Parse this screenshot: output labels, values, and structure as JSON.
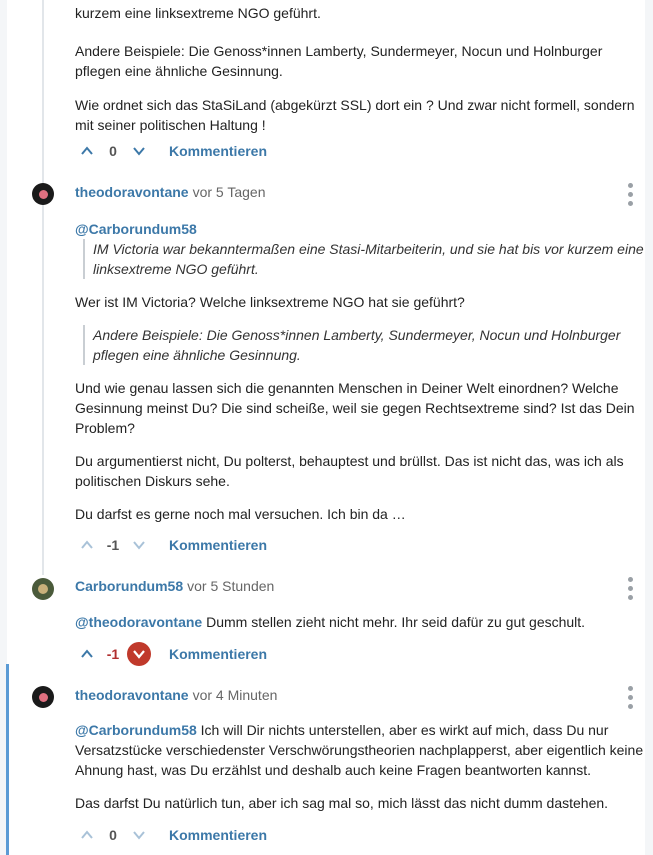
{
  "comments": [
    {
      "paragraphs": [
        "kurzem eine linksextreme NGO geführt.",
        "Andere Beispiele: Die Genoss*innen Lamberty, Sundermeyer, Nocun und Holnburger pflegen eine ähnliche Gesinnung.",
        "Wie ordnet sich das StaSiLand (abgekürzt SSL) dort ein ? Und zwar nicht formell, sondern mit seiner politischen Haltung !"
      ],
      "votes": "0",
      "comment_label": "Kommentieren"
    },
    {
      "user": "theodoravontane",
      "time": "vor 5 Tagen",
      "mention": "@Carborundum58",
      "quote1": "IM Victoria war bekanntermaßen eine Stasi-Mitarbeiterin, und sie hat bis vor kurzem eine linksextreme NGO geführt.",
      "p1": "Wer ist IM Victoria? Welche linksextreme NGO hat sie geführt?",
      "quote2": "Andere Beispiele: Die Genoss*innen Lamberty, Sundermeyer, Nocun und Holnburger pflegen eine ähnliche Gesinnung.",
      "p2": "Und wie genau lassen sich die genannten Menschen in Deiner Welt einordnen? Welche Gesinnung meinst Du? Die sind scheiße, weil sie gegen Rechtsextreme sind? Ist das Dein Problem?",
      "p3": "Du argumentierst nicht, Du polterst, behauptest und brüllst. Das ist nicht das, was ich als politischen Diskurs sehe.",
      "p4": "Du darfst es gerne noch mal versuchen. Ich bin da …",
      "votes": "-1",
      "comment_label": "Kommentieren"
    },
    {
      "user": "Carborundum58",
      "time": "vor 5 Stunden",
      "mention": "@theodoravontane",
      "text": "Dumm stellen zieht nicht mehr. Ihr seid dafür zu gut geschult.",
      "votes": "-1",
      "comment_label": "Kommentieren"
    },
    {
      "user": "theodoravontane",
      "time": "vor 4 Minuten",
      "mention": "@Carborundum58",
      "text": "Ich will Dir nichts unterstellen, aber es wirkt auf mich, dass Du nur Versatzstücke verschiedenster Verschwörungstheorien nachplapperst, aber eigentlich keine Ahnung hast, was Du erzählst und deshalb auch keine Fragen beantworten kannst.",
      "p2": "Das darfst Du natürlich tun, aber ich sag mal so, mich lässt das nicht dumm dastehen.",
      "votes": "0",
      "comment_label": "Kommentieren"
    }
  ],
  "colors": {
    "accent": "#3c78a8",
    "downvote_active": "#c0392b",
    "reply_bar": "#5b9bd5"
  }
}
